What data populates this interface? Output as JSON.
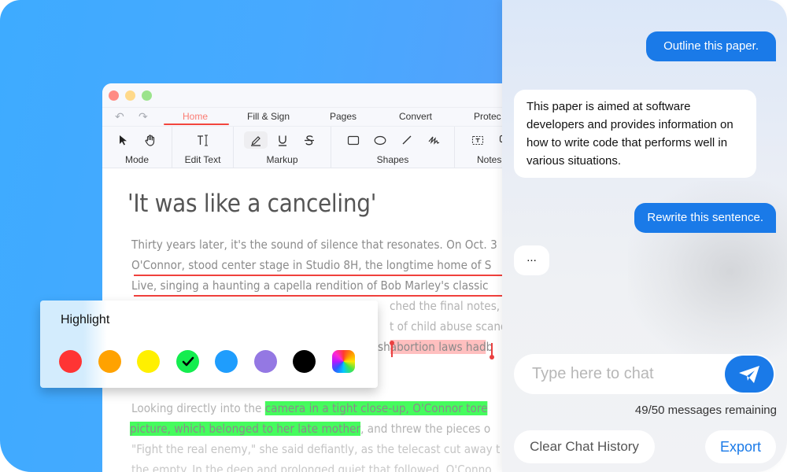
{
  "app": {
    "tabs": [
      {
        "label": "Home",
        "active": true
      },
      {
        "label": "Fill & Sign",
        "active": false
      },
      {
        "label": "Pages",
        "active": false
      },
      {
        "label": "Convert",
        "active": false
      },
      {
        "label": "Protec",
        "active": false
      }
    ],
    "ribbon_groups": [
      {
        "label": "Mode",
        "icons": [
          "arrow-pointer-icon",
          "hand-icon"
        ]
      },
      {
        "label": "Edit Text",
        "icons": [
          "text-cursor-icon"
        ]
      },
      {
        "label": "Markup",
        "icons": [
          "highlighter-pen-icon",
          "underline-icon",
          "strikethrough-icon"
        ]
      },
      {
        "label": "Shapes",
        "icons": [
          "rectangle-icon",
          "ellipse-icon",
          "line-icon",
          "freehand-icon"
        ]
      },
      {
        "label": "Notes",
        "icons": [
          "text-box-icon",
          "comment-icon"
        ]
      }
    ],
    "icon_glyphs": {
      "undo": "↶",
      "redo": "↷",
      "edit_text": "T",
      "underline": "U",
      "strike": "S"
    }
  },
  "document": {
    "heading": "'It was like a canceling'",
    "para1": [
      "Thirty years later, it's the sound of silence that resonates. On Oct. 3",
      "O'Connor, stood center stage in Studio 8H, the longtime home of S",
      "Live, singing a haunting a capella rendition of Bob Marley's classic ",
      "ched the final notes, sh",
      "t of child abuse scanda",
      "sh",
      "abortion laws had",
      "b"
    ],
    "para2": {
      "line1_plain": "Looking directly into the ",
      "line1_hl": "camera in a tight close-up, O'Connor tore",
      "line2_hl": "picture, which belonged to her late mother",
      "line2_plain": ", and threw the pieces o",
      "line3": "\"Fight the real enemy,\" she said defiantly, as the telecast cut away t",
      "line4": "the empty. In the deep and prolonged quiet that followed, O'Conno"
    }
  },
  "highlight_popover": {
    "title": "Highlight",
    "colors": [
      {
        "name": "red",
        "hex": "#ff3434",
        "selected": false
      },
      {
        "name": "orange",
        "hex": "#ffa200",
        "selected": false
      },
      {
        "name": "yellow",
        "hex": "#fff000",
        "selected": false
      },
      {
        "name": "green",
        "hex": "#14ed4f",
        "selected": true
      },
      {
        "name": "blue",
        "hex": "#1f9dfd",
        "selected": false
      },
      {
        "name": "purple",
        "hex": "#9478e3",
        "selected": false
      },
      {
        "name": "black",
        "hex": "#000000",
        "selected": false
      },
      {
        "name": "custom",
        "hex": "rainbow",
        "selected": false
      }
    ],
    "check_glyph": "✔"
  },
  "chat": {
    "messages": [
      {
        "role": "user",
        "text": "Outline this paper."
      },
      {
        "role": "assistant",
        "text": "This paper is aimed at software developers and provides information on how to write code that performs well in various situations."
      },
      {
        "role": "user",
        "text": "Rewrite this sentence."
      },
      {
        "role": "assistant",
        "text": "..."
      }
    ],
    "input_placeholder": "Type here to chat",
    "remaining": "49/50 messages remaining",
    "clear_label": "Clear Chat History",
    "export_label": "Export",
    "accent": "#1a7ae8"
  }
}
